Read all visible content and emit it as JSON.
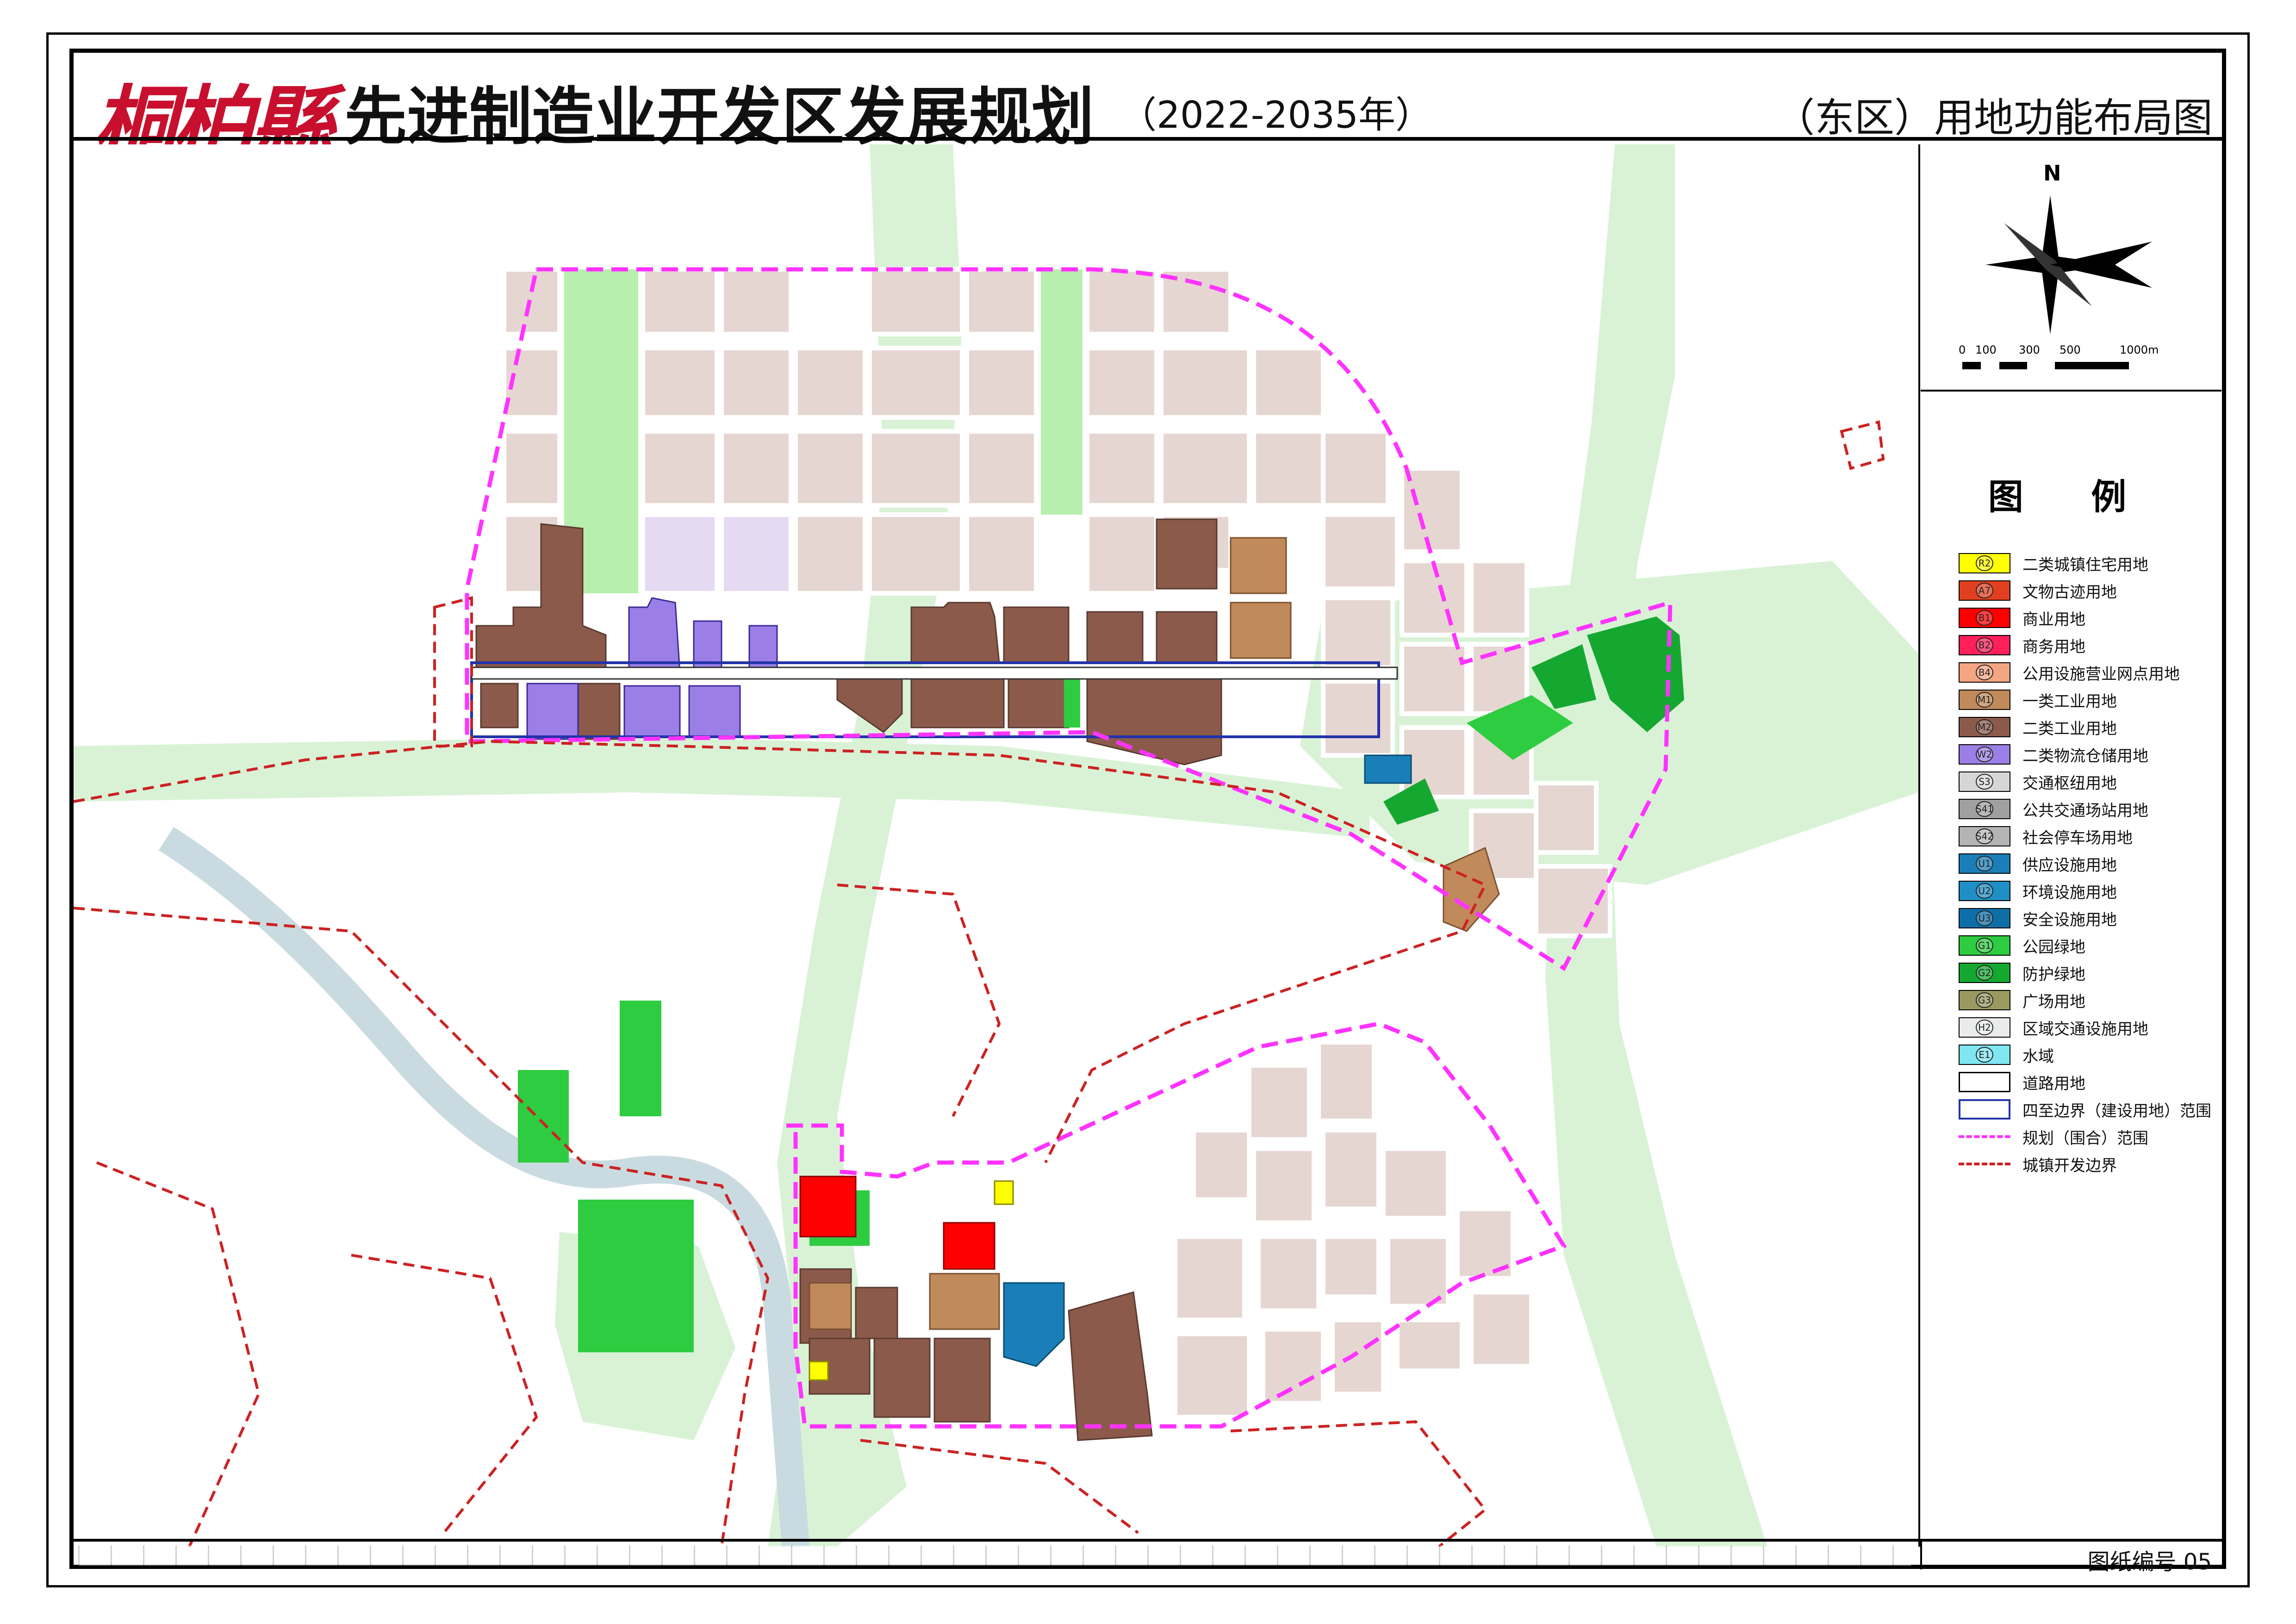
{
  "title": {
    "logo": "桐柏縣",
    "main": "先进制造业开发区发展规划",
    "years": "（2022-2035年）",
    "subtitle": "（东区）用地功能布局图"
  },
  "compass": {
    "north": "N",
    "scale_labels": [
      "0",
      "100",
      "300",
      "500",
      "1000m"
    ]
  },
  "legend": {
    "title": "图  例",
    "items": [
      {
        "code": "R2",
        "label": "二类城镇住宅用地",
        "color": "#ffff00"
      },
      {
        "code": "A7",
        "label": "文物古迹用地",
        "color": "#e04020"
      },
      {
        "code": "B1",
        "label": "商业用地",
        "color": "#ff0000"
      },
      {
        "code": "B2",
        "label": "商务用地",
        "color": "#ff1f5a"
      },
      {
        "code": "B4",
        "label": "公用设施营业网点用地",
        "color": "#f4a582"
      },
      {
        "code": "M1",
        "label": "一类工业用地",
        "color": "#c08a5a"
      },
      {
        "code": "M2",
        "label": "二类工业用地",
        "color": "#8b5a4a"
      },
      {
        "code": "W2",
        "label": "二类物流仓储用地",
        "color": "#9b7fe6"
      },
      {
        "code": "S3",
        "label": "交通枢纽用地",
        "color": "#d6d6d6"
      },
      {
        "code": "S41",
        "label": "公共交通场站用地",
        "color": "#a0a0a0"
      },
      {
        "code": "S42",
        "label": "社会停车场用地",
        "color": "#b4b4b4"
      },
      {
        "code": "U1",
        "label": "供应设施用地",
        "color": "#1a7fb8"
      },
      {
        "code": "U2",
        "label": "环境设施用地",
        "color": "#1f8fc6"
      },
      {
        "code": "U3",
        "label": "安全设施用地",
        "color": "#0e6fa8"
      },
      {
        "code": "G1",
        "label": "公园绿地",
        "color": "#2ecc40"
      },
      {
        "code": "G2",
        "label": "防护绿地",
        "color": "#15a830"
      },
      {
        "code": "G3",
        "label": "广场用地",
        "color": "#9a9a60"
      },
      {
        "code": "H2",
        "label": "区域交通设施用地",
        "color": "#e9ecea"
      },
      {
        "code": "E1",
        "label": "水域",
        "color": "#7fe6f2"
      },
      {
        "code": "",
        "label": "道路用地",
        "color": "#ffffff"
      },
      {
        "code": "",
        "label": "四至边界（建设用地）范围",
        "color": "#2233aa"
      },
      {
        "code": "",
        "label": "规划（围合）范围",
        "color": "#ff33ff"
      },
      {
        "code": "",
        "label": "城镇开发边界",
        "color": "#cc2222"
      }
    ]
  },
  "sheet": {
    "label": "图纸编号  05"
  }
}
